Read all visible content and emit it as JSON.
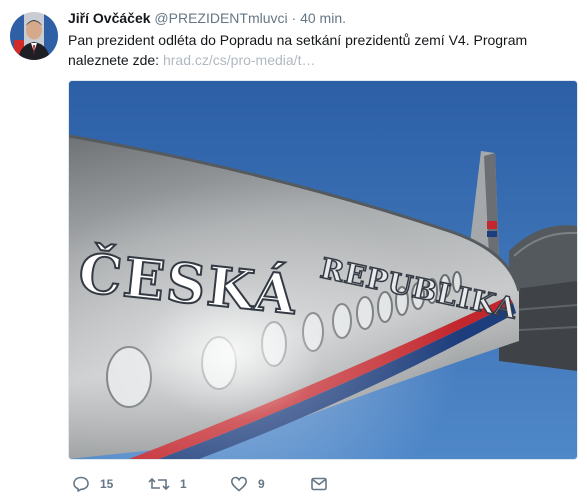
{
  "tweet": {
    "author_name": "Jiří Ovčáček",
    "handle": "@PREZIDENTmluvci",
    "separator": "·",
    "time": "40 min.",
    "text": "Pan prezident odléta do Popradu na setkání prezidentů zemí V4. Program naleznete zde: ",
    "link": "hrad.cz/cs/pro-media/t…",
    "image_text_line1": "ČESKÁ",
    "image_text_line2": "REPUBLIKA"
  },
  "actions": {
    "reply_count": "15",
    "retweet_count": "1",
    "like_count": "9"
  },
  "colors": {
    "link": "#b0b9c1",
    "muted": "#657786",
    "sky": "#2f62a8",
    "fuselage": "#9c9fa1",
    "stripe_red": "#c2272d",
    "stripe_blue": "#1d3d7c"
  },
  "icons": [
    "reply-icon",
    "retweet-icon",
    "like-icon",
    "direct-message-icon"
  ]
}
